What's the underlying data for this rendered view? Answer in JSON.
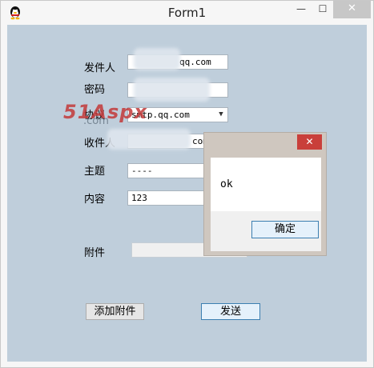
{
  "window": {
    "title": "Form1",
    "icons": {
      "app": "qq-penguin-icon",
      "minimize": "minimize-icon",
      "maximize": "maximize-icon",
      "close": "close-icon"
    },
    "controls": {
      "minimize": "—",
      "maximize": "☐",
      "close": "✕"
    }
  },
  "form": {
    "sender_label": "发件人",
    "sender_value": "qq.com",
    "password_label": "密码",
    "password_value": "",
    "protocol_label": "协议",
    "protocol_value": "smtp.qq.com",
    "recipient_label": "收件人",
    "recipient_value": "com",
    "subject_label": "主题",
    "subject_value": "----",
    "content_label": "内容",
    "content_value": "123",
    "attachment_label": "附件",
    "attachment_value": "",
    "add_attachment_button": "添加附件",
    "send_button": "发送"
  },
  "watermark": {
    "text": "51Aspx",
    "sub": ".com"
  },
  "dialog": {
    "close_label": "✕",
    "message": "ok",
    "ok_button": "确定"
  }
}
